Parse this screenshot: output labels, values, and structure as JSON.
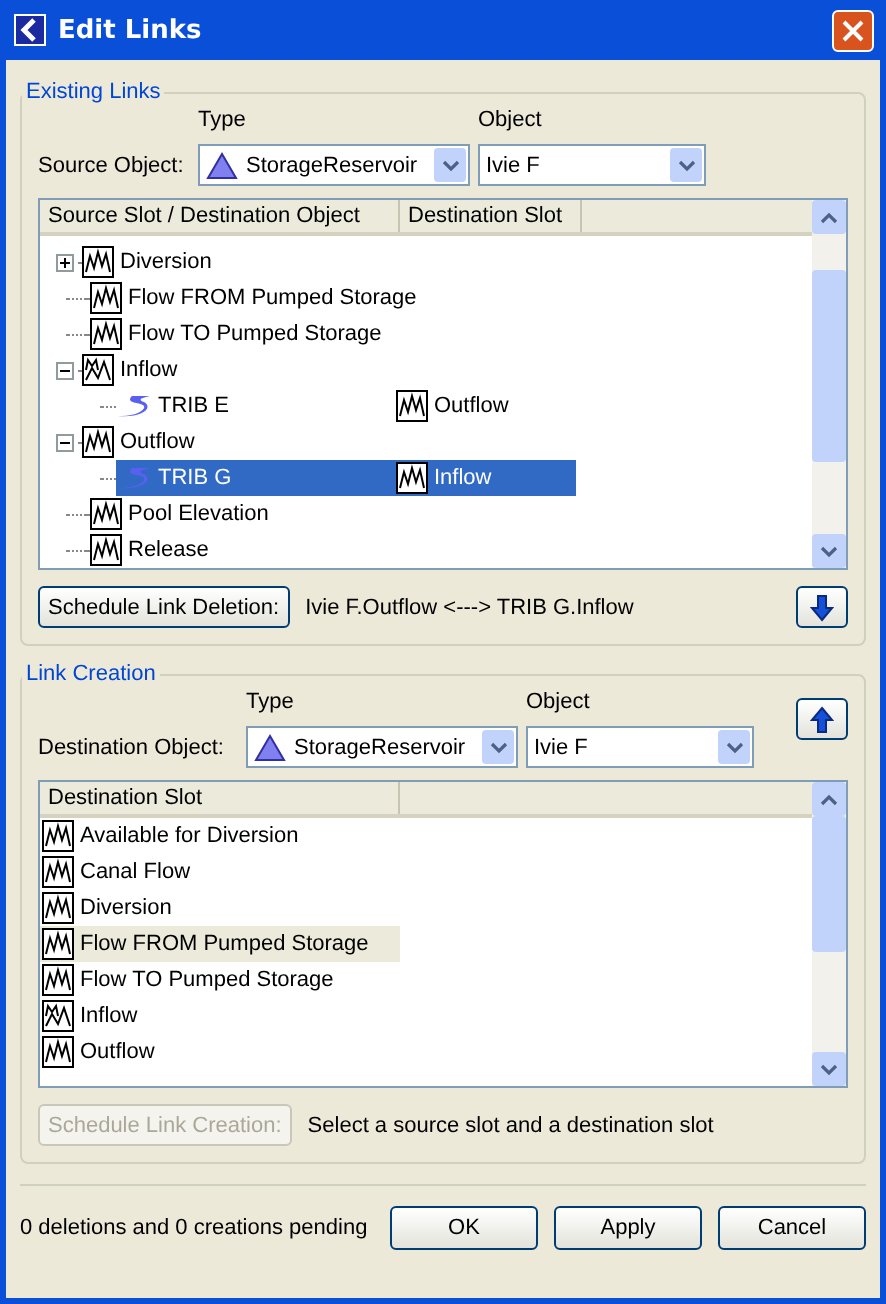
{
  "window": {
    "title": "Edit Links"
  },
  "existing_links": {
    "legend": "Existing Links",
    "type_label": "Type",
    "object_label": "Object",
    "source_label": "Source Object:",
    "type_value": "StorageReservoir",
    "object_value": "Ivie F",
    "columns": [
      "Source Slot / Destination Object",
      "Destination Slot"
    ],
    "slots": [
      {
        "name": "Diversion",
        "kind": "series",
        "expanded": false
      },
      {
        "name": "Flow FROM Pumped Storage",
        "kind": "series"
      },
      {
        "name": "Flow TO Pumped Storage",
        "kind": "series"
      },
      {
        "name": "Inflow",
        "kind": "multi",
        "expanded": true,
        "children": [
          {
            "object": "TRIB E",
            "slot": "Outflow",
            "selected": false
          }
        ]
      },
      {
        "name": "Outflow",
        "kind": "series",
        "expanded": true,
        "children": [
          {
            "object": "TRIB G",
            "slot": "Inflow",
            "selected": true
          }
        ]
      },
      {
        "name": "Pool Elevation",
        "kind": "series"
      },
      {
        "name": "Release",
        "kind": "series"
      }
    ],
    "delete_button": "Schedule Link Deletion:",
    "link_text": "Ivie F.Outflow <---> TRIB G.Inflow"
  },
  "link_creation": {
    "legend": "Link Creation",
    "type_label": "Type",
    "object_label": "Object",
    "dest_label": "Destination Object:",
    "type_value": "StorageReservoir",
    "object_value": "Ivie F",
    "column": "Destination Slot",
    "slots": [
      {
        "name": "Available for Diversion",
        "kind": "series",
        "selected": false
      },
      {
        "name": "Canal Flow",
        "kind": "series",
        "selected": false
      },
      {
        "name": "Diversion",
        "kind": "series",
        "selected": false
      },
      {
        "name": "Flow FROM Pumped Storage",
        "kind": "series",
        "selected": true
      },
      {
        "name": "Flow TO Pumped Storage",
        "kind": "series",
        "selected": false
      },
      {
        "name": "Inflow",
        "kind": "multi",
        "selected": false
      },
      {
        "name": "Outflow",
        "kind": "series",
        "selected": false
      }
    ],
    "create_button": "Schedule Link Creation:",
    "create_disabled": true,
    "hint": "Select a source slot and a destination slot"
  },
  "status": "0 deletions and 0 creations pending",
  "buttons": [
    "OK",
    "Apply",
    "Cancel"
  ]
}
